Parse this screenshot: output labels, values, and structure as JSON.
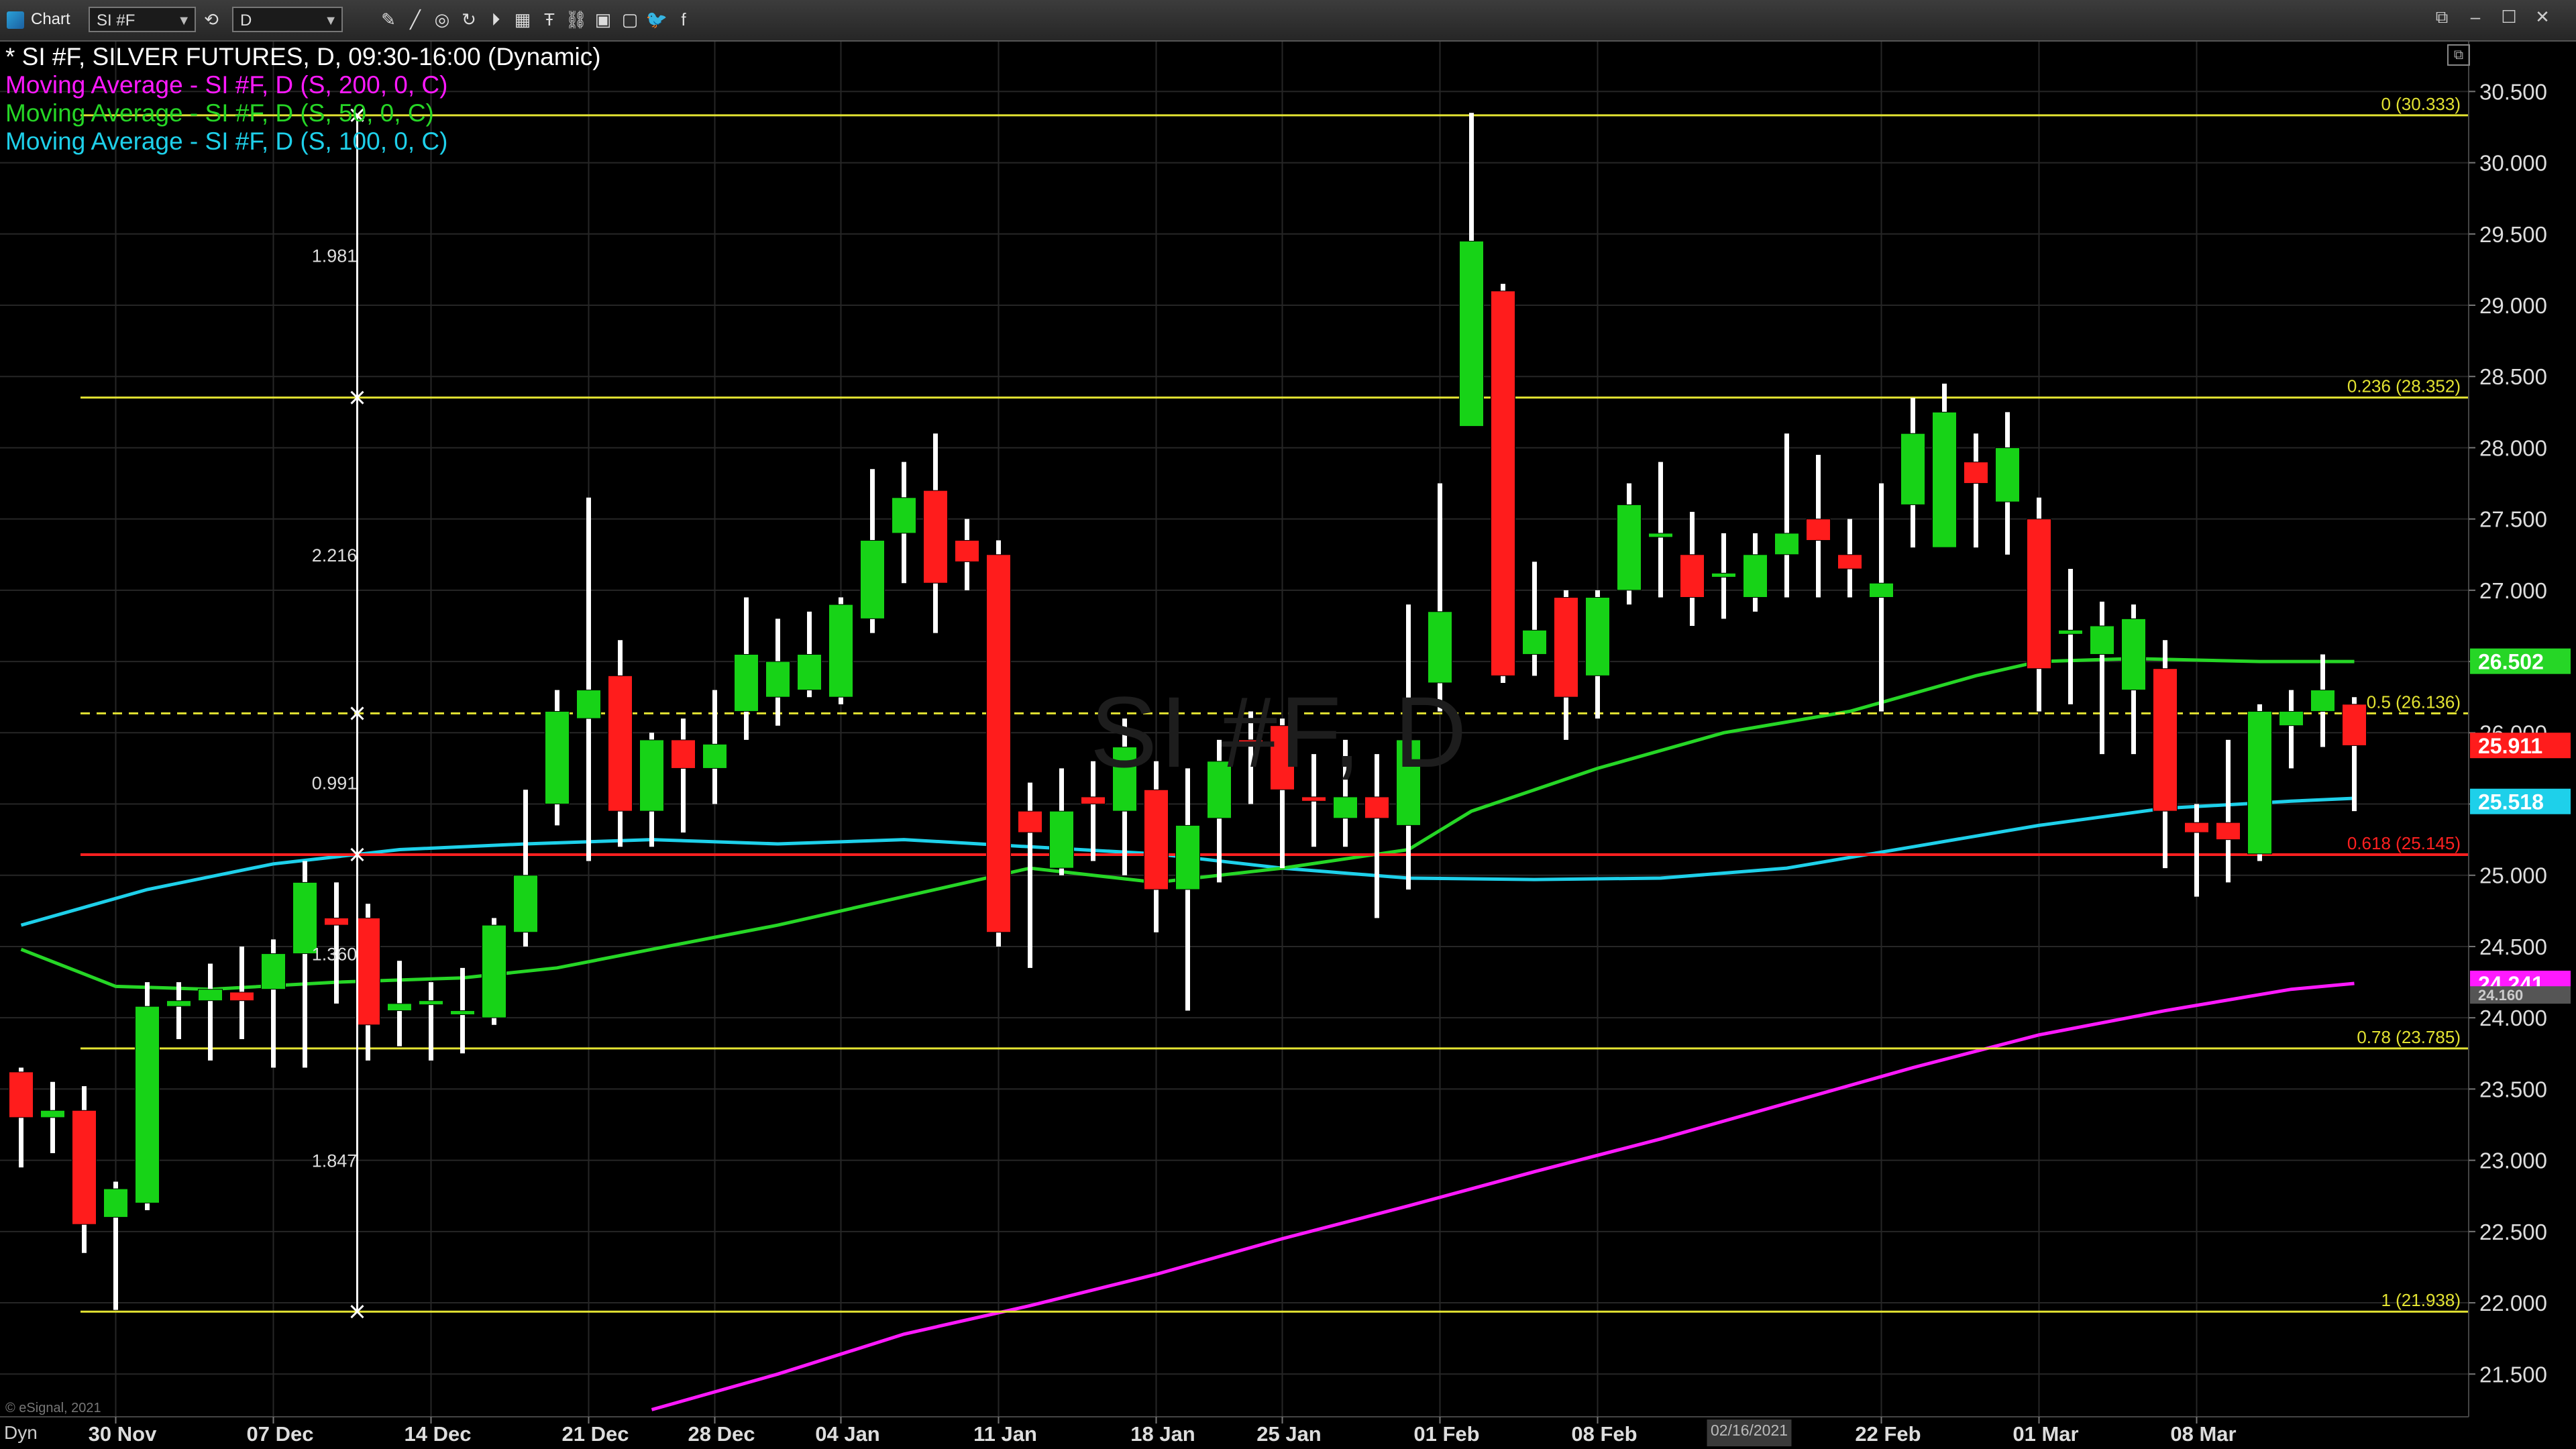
{
  "toolbar": {
    "chart_label": "Chart",
    "symbol_value": "SI #F",
    "interval_value": "D",
    "icons": [
      "link-icon",
      "pencil-icon",
      "cycle-icon",
      "play-icon",
      "grid-icon",
      "text-tool-icon",
      "undo-icon",
      "link-chain-icon",
      "window-icon",
      "twitter-icon",
      "facebook-icon"
    ],
    "window_buttons": [
      "restore-icon",
      "minimize-icon",
      "maximize-icon",
      "close-icon"
    ]
  },
  "legend": {
    "title": "* SI #F, SILVER FUTURES, D, 09:30-16:00 (Dynamic)",
    "ma200": "Moving Average - SI #F, D (S, 200, 0, C)",
    "ma50": "Moving Average - SI #F, D (S, 50, 0, C)",
    "ma100": "Moving Average - SI #F, D (S, 100, 0, C)"
  },
  "watermark": "SI #F, D",
  "copyright": "© eSignal, 2021",
  "dyn_label": "Dyn",
  "colors": {
    "bull": "#17d317",
    "bear": "#ff1c1c",
    "wick": "#ffffff",
    "fib": "#e3e332",
    "ma200": "#ff19ff",
    "ma50": "#26d626",
    "ma100": "#1ed0ea",
    "support": "#ff2020"
  },
  "chart_data": {
    "type": "candlestick",
    "ylim": [
      21.2,
      30.85
    ],
    "y_ticks": [
      "21.500",
      "22.000",
      "22.500",
      "23.000",
      "23.500",
      "24.000",
      "24.500",
      "25.000",
      "25.500",
      "26.000",
      "26.500",
      "27.000",
      "27.500",
      "28.000",
      "28.500",
      "29.000",
      "29.500",
      "30.000",
      "30.500"
    ],
    "x_labels": [
      {
        "label": "30 Nov",
        "i": 3
      },
      {
        "label": "07 Dec",
        "i": 8
      },
      {
        "label": "14 Dec",
        "i": 13
      },
      {
        "label": "21 Dec",
        "i": 18
      },
      {
        "label": "28 Dec",
        "i": 22
      },
      {
        "label": "04 Jan",
        "i": 26
      },
      {
        "label": "11 Jan",
        "i": 31
      },
      {
        "label": "18 Jan",
        "i": 36
      },
      {
        "label": "25 Jan",
        "i": 40
      },
      {
        "label": "01 Feb",
        "i": 45
      },
      {
        "label": "08 Feb",
        "i": 50
      },
      {
        "label": "22 Feb",
        "i": 59
      },
      {
        "label": "01 Mar",
        "i": 64
      },
      {
        "label": "08 Mar",
        "i": 69
      }
    ],
    "cursor_date": "02/16/2021",
    "cursor_index": 55,
    "candles": [
      [
        23.62,
        23.65,
        22.95,
        23.3
      ],
      [
        23.3,
        23.55,
        23.05,
        23.35
      ],
      [
        23.35,
        23.52,
        22.35,
        22.55
      ],
      [
        22.6,
        22.85,
        21.95,
        22.8
      ],
      [
        22.7,
        24.25,
        22.65,
        24.08
      ],
      [
        24.08,
        24.25,
        23.85,
        24.12
      ],
      [
        24.12,
        24.38,
        23.7,
        24.2
      ],
      [
        24.18,
        24.5,
        23.85,
        24.12
      ],
      [
        24.2,
        24.55,
        23.65,
        24.45
      ],
      [
        24.45,
        25.1,
        23.65,
        24.95
      ],
      [
        24.7,
        24.95,
        24.1,
        24.65
      ],
      [
        24.7,
        24.8,
        23.7,
        23.95
      ],
      [
        24.05,
        24.4,
        23.8,
        24.1
      ],
      [
        24.12,
        24.25,
        23.7,
        24.12
      ],
      [
        24.05,
        24.35,
        23.75,
        24.05
      ],
      [
        24.0,
        24.7,
        23.95,
        24.65
      ],
      [
        24.6,
        25.6,
        24.5,
        25.0
      ],
      [
        25.5,
        26.3,
        25.35,
        26.15
      ],
      [
        26.1,
        27.65,
        25.1,
        26.3
      ],
      [
        26.4,
        26.65,
        25.2,
        25.45
      ],
      [
        25.45,
        26.0,
        25.2,
        25.95
      ],
      [
        25.95,
        26.1,
        25.3,
        25.75
      ],
      [
        25.75,
        26.3,
        25.5,
        25.92
      ],
      [
        26.15,
        26.95,
        25.95,
        26.55
      ],
      [
        26.25,
        26.8,
        26.05,
        26.5
      ],
      [
        26.3,
        26.85,
        26.25,
        26.55
      ],
      [
        26.25,
        26.95,
        26.2,
        26.9
      ],
      [
        26.8,
        27.85,
        26.7,
        27.35
      ],
      [
        27.4,
        27.9,
        27.05,
        27.65
      ],
      [
        27.7,
        28.1,
        26.7,
        27.05
      ],
      [
        27.35,
        27.5,
        27.0,
        27.2
      ],
      [
        27.25,
        27.35,
        24.5,
        24.6
      ],
      [
        25.45,
        25.65,
        24.35,
        25.3
      ],
      [
        25.05,
        25.75,
        25.0,
        25.45
      ],
      [
        25.55,
        25.8,
        25.1,
        25.5
      ],
      [
        25.45,
        26.1,
        25.0,
        25.9
      ],
      [
        25.6,
        25.8,
        24.6,
        24.9
      ],
      [
        24.9,
        25.75,
        24.05,
        25.35
      ],
      [
        25.4,
        25.95,
        24.95,
        25.8
      ],
      [
        25.95,
        26.15,
        25.5,
        25.92
      ],
      [
        26.05,
        26.1,
        25.05,
        25.6
      ],
      [
        25.55,
        25.85,
        25.2,
        25.52
      ],
      [
        25.4,
        25.95,
        25.2,
        25.55
      ],
      [
        25.55,
        25.85,
        24.7,
        25.4
      ],
      [
        25.35,
        26.9,
        24.9,
        25.95
      ],
      [
        26.35,
        27.75,
        26.15,
        26.85
      ],
      [
        28.15,
        30.35,
        28.15,
        29.45
      ],
      [
        29.1,
        29.15,
        26.35,
        26.4
      ],
      [
        26.55,
        27.2,
        26.4,
        26.72
      ],
      [
        26.95,
        27.0,
        25.95,
        26.25
      ],
      [
        26.4,
        27.0,
        26.1,
        26.95
      ],
      [
        27.0,
        27.75,
        26.9,
        27.6
      ],
      [
        27.4,
        27.9,
        26.95,
        27.4
      ],
      [
        27.25,
        27.55,
        26.75,
        26.95
      ],
      [
        27.1,
        27.4,
        26.8,
        27.12
      ],
      [
        26.95,
        27.4,
        26.85,
        27.25
      ],
      [
        27.25,
        28.1,
        26.95,
        27.4
      ],
      [
        27.5,
        27.95,
        26.95,
        27.35
      ],
      [
        27.25,
        27.5,
        26.95,
        27.15
      ],
      [
        26.95,
        27.75,
        26.15,
        27.05
      ],
      [
        27.6,
        28.35,
        27.3,
        28.1
      ],
      [
        27.3,
        28.45,
        27.3,
        28.25
      ],
      [
        27.9,
        28.1,
        27.3,
        27.75
      ],
      [
        27.62,
        28.25,
        27.25,
        28.0
      ],
      [
        27.5,
        27.65,
        26.15,
        26.45
      ],
      [
        26.7,
        27.15,
        26.2,
        26.72
      ],
      [
        26.55,
        26.92,
        25.85,
        26.75
      ],
      [
        26.3,
        26.9,
        25.85,
        26.8
      ],
      [
        26.45,
        26.65,
        25.05,
        25.45
      ],
      [
        25.37,
        25.5,
        24.85,
        25.3
      ],
      [
        25.37,
        25.95,
        24.95,
        25.25
      ],
      [
        25.15,
        26.2,
        25.1,
        26.15
      ],
      [
        26.05,
        26.3,
        25.75,
        26.15
      ],
      [
        26.15,
        26.55,
        25.9,
        26.3
      ],
      [
        26.2,
        26.25,
        25.45,
        25.91
      ]
    ],
    "ma50": [
      [
        0,
        24.48
      ],
      [
        3,
        24.22
      ],
      [
        6,
        24.2
      ],
      [
        10,
        24.25
      ],
      [
        14,
        24.28
      ],
      [
        17,
        24.35
      ],
      [
        20,
        24.48
      ],
      [
        24,
        24.65
      ],
      [
        28,
        24.85
      ],
      [
        32,
        25.05
      ],
      [
        36,
        24.95
      ],
      [
        40,
        25.05
      ],
      [
        44,
        25.18
      ],
      [
        46,
        25.45
      ],
      [
        50,
        25.75
      ],
      [
        54,
        26.0
      ],
      [
        58,
        26.15
      ],
      [
        62,
        26.4
      ],
      [
        64,
        26.5
      ],
      [
        67,
        26.52
      ],
      [
        71,
        26.5
      ],
      [
        74,
        26.5
      ]
    ],
    "ma100": [
      [
        0,
        24.65
      ],
      [
        4,
        24.9
      ],
      [
        8,
        25.08
      ],
      [
        12,
        25.18
      ],
      [
        16,
        25.22
      ],
      [
        20,
        25.25
      ],
      [
        24,
        25.22
      ],
      [
        28,
        25.25
      ],
      [
        32,
        25.2
      ],
      [
        36,
        25.15
      ],
      [
        40,
        25.05
      ],
      [
        44,
        24.98
      ],
      [
        48,
        24.97
      ],
      [
        52,
        24.98
      ],
      [
        56,
        25.05
      ],
      [
        60,
        25.2
      ],
      [
        64,
        25.35
      ],
      [
        68,
        25.47
      ],
      [
        72,
        25.52
      ],
      [
        74,
        25.54
      ]
    ],
    "ma200": [
      [
        20,
        21.25
      ],
      [
        24,
        21.5
      ],
      [
        28,
        21.78
      ],
      [
        32,
        21.98
      ],
      [
        36,
        22.2
      ],
      [
        40,
        22.45
      ],
      [
        44,
        22.68
      ],
      [
        48,
        22.92
      ],
      [
        52,
        23.15
      ],
      [
        56,
        23.4
      ],
      [
        60,
        23.65
      ],
      [
        64,
        23.88
      ],
      [
        68,
        24.05
      ],
      [
        72,
        24.2
      ],
      [
        74,
        24.241
      ]
    ],
    "fib_levels": [
      {
        "value": 30.333,
        "label": "0 (30.333)"
      },
      {
        "value": 28.352,
        "label": "0.236 (28.352)"
      },
      {
        "value": 26.136,
        "label": "0.5 (26.136)",
        "dashed": true
      },
      {
        "value": 25.145,
        "label": "0.618 (25.145)",
        "red": true
      },
      {
        "value": 23.785,
        "label": "0.78 (23.785)"
      },
      {
        "value": 21.938,
        "label": "1 (21.938)"
      }
    ],
    "measure": {
      "index": 10,
      "top": 30.333,
      "bottom": 21.938,
      "markers": [
        28.352,
        26.136,
        25.145
      ],
      "labels": [
        {
          "text": "1.981",
          "value": 29.35
        },
        {
          "text": "2.216",
          "value": 27.25
        },
        {
          "text": "0.991",
          "value": 25.65
        },
        {
          "text": "1.360",
          "value": 24.45
        },
        {
          "text": "1.847",
          "value": 23.0
        }
      ]
    },
    "price_tags": [
      {
        "text": "26.502",
        "value": 26.502,
        "color": "#26d626"
      },
      {
        "text": "25.911",
        "value": 25.911,
        "color": "#ff1c1c"
      },
      {
        "text": "25.518",
        "value": 25.518,
        "color": "#1ed0ea"
      },
      {
        "text": "24.241",
        "value": 24.241,
        "color": "#ff19ff"
      },
      {
        "text": "24.160",
        "value": 24.16,
        "color": "#555555",
        "small": true
      }
    ]
  }
}
